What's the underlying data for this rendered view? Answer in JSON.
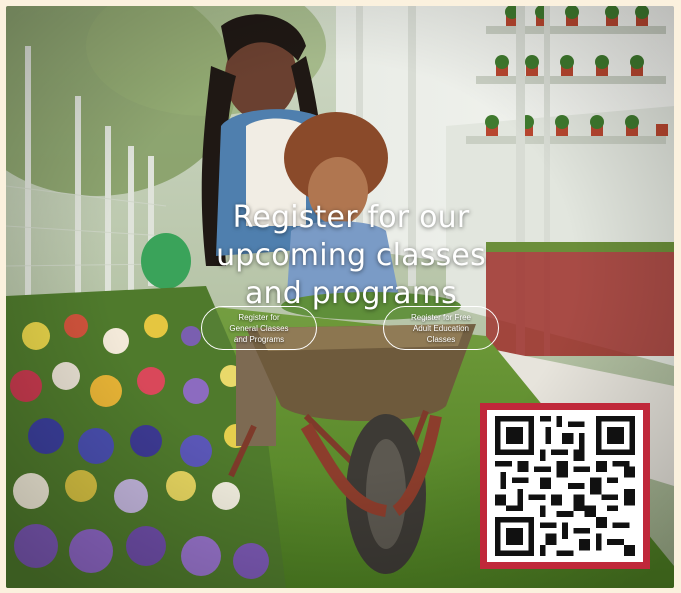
{
  "headline": {
    "line1": "Register for our",
    "line2": "upcoming classes",
    "line3": "and programs"
  },
  "buttons": {
    "general": {
      "line1": "Register for",
      "line2": "General Classes",
      "line3": "and Programs"
    },
    "adult": {
      "line1": "Register for Free",
      "line2": "Adult Education",
      "line3": "Classes"
    }
  },
  "colors": {
    "background": "#fbf1de",
    "qr_border": "#c0283a",
    "text": "#ffffff"
  }
}
